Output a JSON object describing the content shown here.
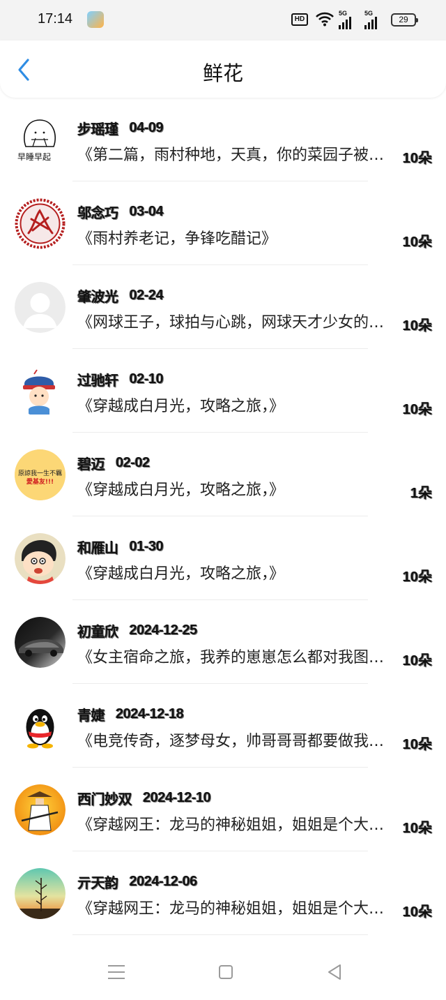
{
  "status_bar": {
    "time": "17:14",
    "hd_label": "HD",
    "signal1_label": "5G",
    "signal2_label": "5G",
    "battery": "29"
  },
  "header": {
    "title": "鲜花"
  },
  "items": [
    {
      "name": "步瑶瑾",
      "date": "04-09",
      "book": "《第二篇，雨村种地，天真，你的菜园子被猪拱了》",
      "count": "10朵",
      "avatar_icon": "sleep-early-doodle-icon",
      "avatar_text": "早睡早起"
    },
    {
      "name": "邬念巧",
      "date": "03-04",
      "book": "《雨村养老记，争锋吃醋记》",
      "count": "10朵",
      "avatar_icon": "red-papercut-icon"
    },
    {
      "name": "肇波光",
      "date": "02-24",
      "book": "《网球王子，球拍与心跳，网球天才少女的恋爱日常》",
      "count": "10朵",
      "avatar_icon": "default-user-icon"
    },
    {
      "name": "过驰轩",
      "date": "02-10",
      "book": "《穿越成白月光，攻略之旅，》",
      "count": "10朵",
      "avatar_icon": "cartoon-official-icon"
    },
    {
      "name": "碧迈",
      "date": "02-02",
      "book": "《穿越成白月光，攻略之旅，》",
      "count": "1朵",
      "avatar_icon": "text-meme-icon",
      "avatar_text_1": "原諒我一生不羈",
      "avatar_text_2": "愛基友!!!"
    },
    {
      "name": "和雁山",
      "date": "01-30",
      "book": "《穿越成白月光，攻略之旅，》",
      "count": "10朵",
      "avatar_icon": "crayon-boy-icon"
    },
    {
      "name": "初童欣",
      "date": "2024-12-25",
      "book": "《女主宿命之旅，我养的崽崽怎么都对我图谋不轨》",
      "count": "10朵",
      "avatar_icon": "dark-car-icon"
    },
    {
      "name": "青婕",
      "date": "2024-12-18",
      "book": "《电竞传奇，逐梦母女，帅哥哥哥都要做我的人》",
      "count": "10朵",
      "avatar_icon": "qq-penguin-icon"
    },
    {
      "name": "西门妙双",
      "date": "2024-12-10",
      "book": "《穿越网王：龙马的神秘姐姐，姐姐是个大美人》",
      "count": "10朵",
      "avatar_icon": "swordsman-sunset-icon"
    },
    {
      "name": "亓天韵",
      "date": "2024-12-06",
      "book": "《穿越网王：龙马的神秘姐姐，姐姐是个大美人》",
      "count": "10朵",
      "avatar_icon": "plant-sunset-icon"
    }
  ],
  "nav": {
    "menu_icon": "menu-icon",
    "home_icon": "home-square-icon",
    "back_icon": "back-triangle-icon"
  },
  "colors": {
    "accent": "#2f8de4",
    "background": "#ffffff",
    "status_bar": "#f3f3f3"
  }
}
